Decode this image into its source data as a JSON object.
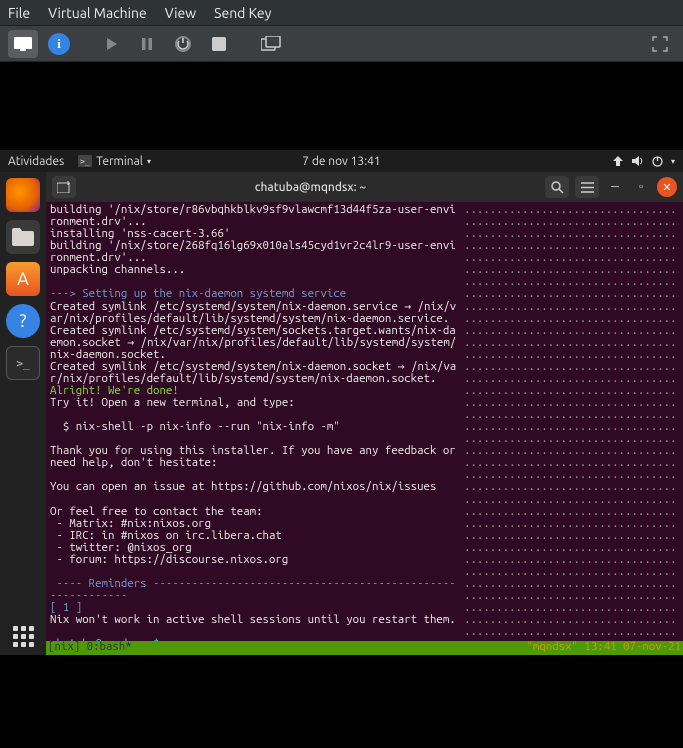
{
  "vm_menu": {
    "file": "File",
    "vm": "Virtual Machine",
    "view": "View",
    "sendkey": "Send Key"
  },
  "gnome": {
    "activities": "Atividades",
    "app_label": "Terminal",
    "datetime": "7 de nov  13:41"
  },
  "terminal": {
    "title": "chatuba@mqndsx: ~",
    "prompt": "chatuba@mqndsx:~$",
    "status_left": "[nix] 0:bash*",
    "status_right": "\"mqndsx\" 13:41 07-nov-21"
  },
  "lines": {
    "l01": "building '/nix/store/r86vbqhkblkv9sf9vlawcmf13d44f5za-user-environment.drv'...",
    "l02": "installing 'nss-cacert-3.66'",
    "l03": "building '/nix/store/268fq16lg69x010als45cyd1vr2c4lr9-user-environment.drv'...",
    "l04": "unpacking channels...",
    "l05": "",
    "l06": "---> Setting up the nix-daemon systemd service",
    "l07": "Created symlink /etc/systemd/system/nix-daemon.service → /nix/var/nix/profiles/default/lib/systemd/system/nix-daemon.service.",
    "l08": "Created symlink /etc/systemd/system/sockets.target.wants/nix-daemon.socket → /nix/var/nix/profiles/default/lib/systemd/system/nix-daemon.socket.",
    "l09": "Created symlink /etc/systemd/system/nix-daemon.socket → /nix/var/nix/profiles/default/lib/systemd/system/nix-daemon.socket.",
    "l10": "Alright! We're done!",
    "l11": "Try it! Open a new terminal, and type:",
    "l12": "",
    "l13": "  $ nix-shell -p nix-info --run \"nix-info -m\"",
    "l14": "",
    "l15": "Thank you for using this installer. If you have any feedback or need help, don't hesitate:",
    "l16": "",
    "l17": "You can open an issue at https://github.com/nixos/nix/issues",
    "l18": "",
    "l19": "Or feel free to contact the team:",
    "l20": " - Matrix: #nix:nixos.org",
    "l21": " - IRC: in #nixos on irc.libera.chat",
    "l22": " - twitter: @nixos_org",
    "l23": " - forum: https://discourse.nixos.org",
    "l24": "",
    "l25": " ---- Reminders -----------------------------------------------------------",
    "l26": "[ 1 ]",
    "l27": "Nix won't work in active shell sessions until you restart them.",
    "l28": ""
  }
}
